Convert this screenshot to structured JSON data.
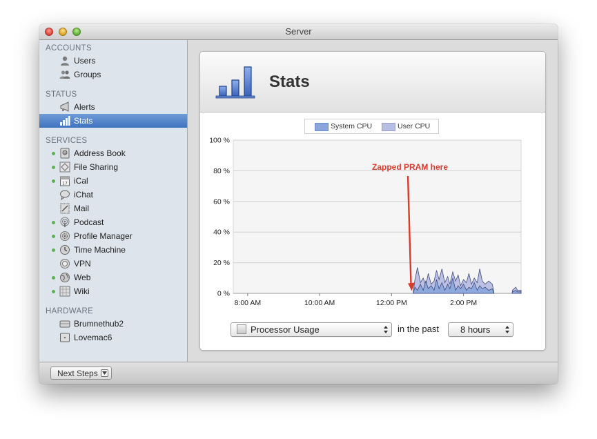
{
  "window": {
    "title": "Server"
  },
  "sidebar": {
    "sections": [
      {
        "header": "ACCOUNTS",
        "items": [
          {
            "label": "Users",
            "icon": "user-icon",
            "dot": false
          },
          {
            "label": "Groups",
            "icon": "group-icon",
            "dot": false
          }
        ]
      },
      {
        "header": "STATUS",
        "items": [
          {
            "label": "Alerts",
            "icon": "megaphone-icon",
            "dot": false
          },
          {
            "label": "Stats",
            "icon": "bar-chart-icon",
            "dot": false,
            "selected": true
          }
        ]
      },
      {
        "header": "SERVICES",
        "items": [
          {
            "label": "Address Book",
            "icon": "address-book-icon",
            "dot": true
          },
          {
            "label": "File Sharing",
            "icon": "file-sharing-icon",
            "dot": true
          },
          {
            "label": "iCal",
            "icon": "calendar-icon",
            "dot": true
          },
          {
            "label": "iChat",
            "icon": "chat-bubble-icon",
            "dot": false
          },
          {
            "label": "Mail",
            "icon": "mail-stamp-icon",
            "dot": false
          },
          {
            "label": "Podcast",
            "icon": "podcast-icon",
            "dot": true
          },
          {
            "label": "Profile Manager",
            "icon": "gear-icon",
            "dot": true
          },
          {
            "label": "Time Machine",
            "icon": "clock-icon",
            "dot": true
          },
          {
            "label": "VPN",
            "icon": "vpn-icon",
            "dot": false
          },
          {
            "label": "Web",
            "icon": "globe-icon",
            "dot": true
          },
          {
            "label": "Wiki",
            "icon": "wiki-icon",
            "dot": true
          }
        ]
      },
      {
        "header": "HARDWARE",
        "items": [
          {
            "label": "Brumnethub2",
            "icon": "server-drive-icon",
            "dot": false
          },
          {
            "label": "Lovemac6",
            "icon": "mac-mini-icon",
            "dot": false
          }
        ]
      }
    ]
  },
  "panel": {
    "title": "Stats"
  },
  "legend": [
    {
      "label": "System CPU",
      "color": "#8aa6dc"
    },
    {
      "label": "User CPU",
      "color": "#b7bde3"
    }
  ],
  "chart_data": {
    "type": "area",
    "title": "",
    "xlabel": "",
    "ylabel": "",
    "y_ticks": [
      "0 %",
      "20 %",
      "40 %",
      "60 %",
      "80 %",
      "100 %"
    ],
    "ylim": [
      0,
      100
    ],
    "x_ticks": [
      "8:00 AM",
      "10:00 AM",
      "12:00 PM",
      "2:00 PM"
    ],
    "x_tick_hours": [
      8,
      10,
      12,
      14
    ],
    "xlim_hours": [
      7.6,
      15.6
    ],
    "grid": true,
    "legend_position": "top-center",
    "annotation": {
      "text": "Zapped PRAM here",
      "color": "#d93b2b",
      "x_hour": 12.55,
      "y": 2
    },
    "series": [
      {
        "name": "User CPU",
        "color": "#b7bde3",
        "segments": [
          [
            [
              12.6,
              0
            ],
            [
              12.65,
              9
            ],
            [
              12.72,
              17
            ],
            [
              12.8,
              7
            ],
            [
              12.88,
              10
            ],
            [
              12.95,
              5
            ],
            [
              13.02,
              13
            ],
            [
              13.1,
              6
            ],
            [
              13.18,
              8
            ],
            [
              13.25,
              15
            ],
            [
              13.32,
              9
            ],
            [
              13.4,
              16
            ],
            [
              13.48,
              7
            ],
            [
              13.56,
              11
            ],
            [
              13.62,
              6
            ],
            [
              13.7,
              14
            ],
            [
              13.78,
              8
            ],
            [
              13.85,
              12
            ],
            [
              13.92,
              5
            ],
            [
              14.0,
              9
            ],
            [
              14.08,
              7
            ],
            [
              14.15,
              13
            ],
            [
              14.22,
              6
            ],
            [
              14.3,
              10
            ],
            [
              14.38,
              7
            ],
            [
              14.45,
              16
            ],
            [
              14.52,
              8
            ],
            [
              14.6,
              6
            ],
            [
              14.7,
              8
            ],
            [
              14.8,
              6
            ],
            [
              14.85,
              0
            ]
          ],
          [
            [
              15.35,
              0
            ],
            [
              15.36,
              2
            ],
            [
              15.45,
              4
            ],
            [
              15.5,
              2
            ],
            [
              15.6,
              2
            ]
          ]
        ]
      },
      {
        "name": "System CPU",
        "color": "#8aa6dc",
        "segments": [
          [
            [
              12.6,
              0
            ],
            [
              12.65,
              4
            ],
            [
              12.72,
              2
            ],
            [
              12.8,
              6
            ],
            [
              12.88,
              2
            ],
            [
              12.95,
              8
            ],
            [
              13.02,
              3
            ],
            [
              13.1,
              5
            ],
            [
              13.18,
              2
            ],
            [
              13.25,
              9
            ],
            [
              13.32,
              3
            ],
            [
              13.4,
              7
            ],
            [
              13.48,
              2
            ],
            [
              13.56,
              6
            ],
            [
              13.62,
              3
            ],
            [
              13.7,
              10
            ],
            [
              13.78,
              2
            ],
            [
              13.85,
              5
            ],
            [
              13.92,
              3
            ],
            [
              14.0,
              6
            ],
            [
              14.08,
              2
            ],
            [
              14.15,
              4
            ],
            [
              14.22,
              3
            ],
            [
              14.3,
              7
            ],
            [
              14.38,
              2
            ],
            [
              14.45,
              5
            ],
            [
              14.52,
              3
            ],
            [
              14.6,
              4
            ],
            [
              14.7,
              2
            ],
            [
              14.8,
              3
            ],
            [
              14.85,
              0
            ]
          ],
          [
            [
              15.35,
              0
            ],
            [
              15.36,
              1
            ],
            [
              15.45,
              2
            ],
            [
              15.5,
              1
            ],
            [
              15.6,
              1
            ]
          ]
        ]
      }
    ]
  },
  "controls": {
    "metric": "Processor Usage",
    "in_the_past": "in the past",
    "range": "8 hours"
  },
  "bottom": {
    "next_steps": "Next Steps"
  }
}
